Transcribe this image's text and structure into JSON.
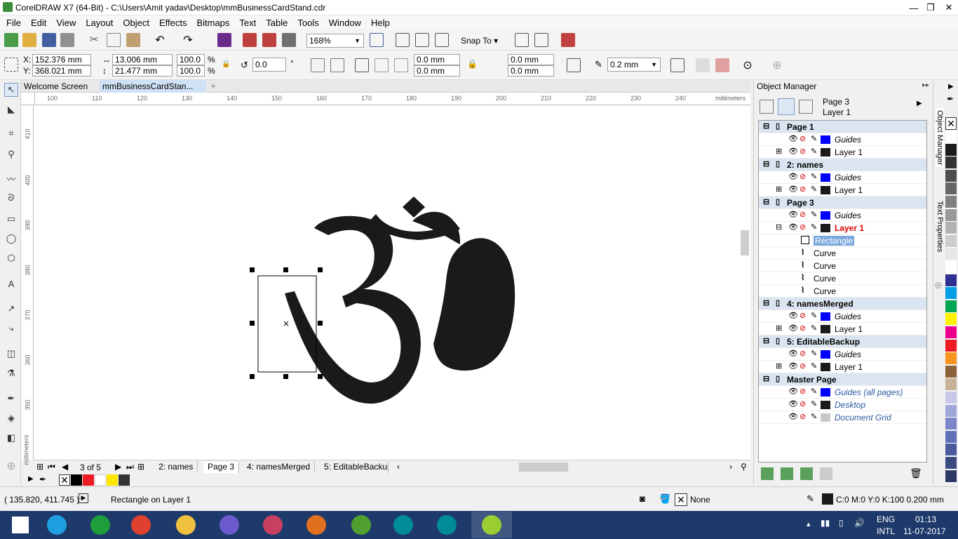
{
  "window": {
    "title": "CorelDRAW X7 (64-Bit) - C:\\Users\\Amit yadav\\Desktop\\mmBusinessCardStand.cdr",
    "minimize": "—",
    "maximize": "❐",
    "close": "✕"
  },
  "menu": [
    "File",
    "Edit",
    "View",
    "Layout",
    "Object",
    "Effects",
    "Bitmaps",
    "Text",
    "Table",
    "Tools",
    "Window",
    "Help"
  ],
  "toolbar": {
    "zoom": "168%",
    "snap_to": "Snap To"
  },
  "property_bar": {
    "x_label": "X:",
    "x": "152.376 mm",
    "y_label": "Y:",
    "y": "368.021 mm",
    "width": "13.006 mm",
    "height": "21.477 mm",
    "scale_w": "100.0",
    "scale_h": "100.0",
    "pct": "%",
    "rotation": "0.0",
    "deg": "°",
    "corner_tl": "0.0 mm",
    "corner_bl": "0.0 mm",
    "corner_tr": "0.0 mm",
    "corner_br": "0.0 mm",
    "outline": "0.2 mm"
  },
  "doc_tabs": [
    "Welcome Screen",
    "mmBusinessCardStan...",
    "+"
  ],
  "ruler": {
    "h_ticks": [
      "100",
      "110",
      "120",
      "130",
      "140",
      "150",
      "160",
      "170",
      "180",
      "190",
      "200",
      "210",
      "220",
      "230",
      "240"
    ],
    "h_unit": "millimeters",
    "v_ticks": [
      "410",
      "400",
      "390",
      "380",
      "370",
      "360",
      "350"
    ],
    "v_unit": "millimeters"
  },
  "page_nav": {
    "counter": "3 of 5",
    "tabs": [
      "2: names",
      "Page 3",
      "4: namesMerged",
      "5: EditableBackup"
    ]
  },
  "object_manager": {
    "title": "Object Manager",
    "current_page": "Page 3",
    "current_layer": "Layer 1",
    "tree": [
      {
        "kind": "page",
        "label": "Page 1"
      },
      {
        "kind": "layer",
        "label": "Guides",
        "color": "#0000ff",
        "italic": true,
        "expand": ""
      },
      {
        "kind": "layer",
        "label": "Layer 1",
        "color": "#1a1a1a",
        "italic": false,
        "expand": "+"
      },
      {
        "kind": "page",
        "label": "2: names"
      },
      {
        "kind": "layer",
        "label": "Guides",
        "color": "#0000ff",
        "italic": true,
        "expand": ""
      },
      {
        "kind": "layer",
        "label": "Layer 1",
        "color": "#1a1a1a",
        "italic": false,
        "expand": "+"
      },
      {
        "kind": "page",
        "label": "Page 3"
      },
      {
        "kind": "layer",
        "label": "Guides",
        "color": "#0000ff",
        "italic": true,
        "expand": ""
      },
      {
        "kind": "layer",
        "label": "Layer 1",
        "color": "#1a1a1a",
        "italic": false,
        "expand": "−",
        "active": true
      },
      {
        "kind": "object",
        "label": "Rectangle",
        "icon": "rect",
        "selected": true
      },
      {
        "kind": "object",
        "label": "Curve",
        "icon": "curve"
      },
      {
        "kind": "object",
        "label": "Curve",
        "icon": "curve"
      },
      {
        "kind": "object",
        "label": "Curve",
        "icon": "curve"
      },
      {
        "kind": "object",
        "label": "Curve",
        "icon": "curve"
      },
      {
        "kind": "page",
        "label": "4: namesMerged"
      },
      {
        "kind": "layer",
        "label": "Guides",
        "color": "#0000ff",
        "italic": true,
        "expand": ""
      },
      {
        "kind": "layer",
        "label": "Layer 1",
        "color": "#1a1a1a",
        "italic": false,
        "expand": "+"
      },
      {
        "kind": "page",
        "label": "5: EditableBackup"
      },
      {
        "kind": "layer",
        "label": "Guides",
        "color": "#0000ff",
        "italic": true,
        "expand": ""
      },
      {
        "kind": "layer",
        "label": "Layer 1",
        "color": "#1a1a1a",
        "italic": false,
        "expand": "+"
      },
      {
        "kind": "page",
        "label": "Master Page"
      },
      {
        "kind": "master",
        "label": "Guides (all pages)",
        "color": "#0000ff"
      },
      {
        "kind": "master",
        "label": "Desktop",
        "color": "#1a1a1a"
      },
      {
        "kind": "master",
        "label": "Document Grid",
        "color": "#c8c8c8"
      }
    ]
  },
  "side_tabs": [
    "Object Manager",
    "Text Properties"
  ],
  "palette": [
    "#ffffff",
    "#1a1a1a",
    "#333333",
    "#4d4d4d",
    "#666666",
    "#808080",
    "#999999",
    "#b3b3b3",
    "#cccccc",
    "#e6e6e6",
    "#ffffff",
    "#2e3192",
    "#00a0e9",
    "#00a651",
    "#fff200",
    "#ec008c",
    "#ed1c24",
    "#f7941d",
    "#8c6239",
    "#c7b299",
    "#c8c8e8",
    "#9ea7d8",
    "#7b86c8",
    "#6070b8",
    "#4a5a9c",
    "#3b4a80",
    "#2d3a66"
  ],
  "doc_palette": [
    "#000000",
    "#ed1c24",
    "#ffffff",
    "#ffe600",
    "#333333"
  ],
  "status": {
    "cursor": "( 135.820, 411.745 )",
    "selection": "Rectangle on Layer 1",
    "fill": "None",
    "outline": "C:0 M:0 Y:0 K:100  0.200 mm"
  },
  "taskbar": {
    "lang1": "ENG",
    "lang2": "INTL",
    "time": "01:13",
    "date": "11-07-2017",
    "apps": [
      {
        "name": "start",
        "color": "#ffffff"
      },
      {
        "name": "ie",
        "color": "#1ea0e0"
      },
      {
        "name": "store",
        "color": "#1e9e3a"
      },
      {
        "name": "chrome",
        "color": "#e04030"
      },
      {
        "name": "explorer",
        "color": "#f0c040"
      },
      {
        "name": "app6",
        "color": "#6a5acd"
      },
      {
        "name": "app7",
        "color": "#c84060"
      },
      {
        "name": "firefox",
        "color": "#e07020"
      },
      {
        "name": "utorrent",
        "color": "#50a030"
      },
      {
        "name": "arduino",
        "color": "#008c96"
      },
      {
        "name": "arduino2",
        "color": "#008c96"
      },
      {
        "name": "coreldraw",
        "color": "#9acd32"
      }
    ]
  }
}
